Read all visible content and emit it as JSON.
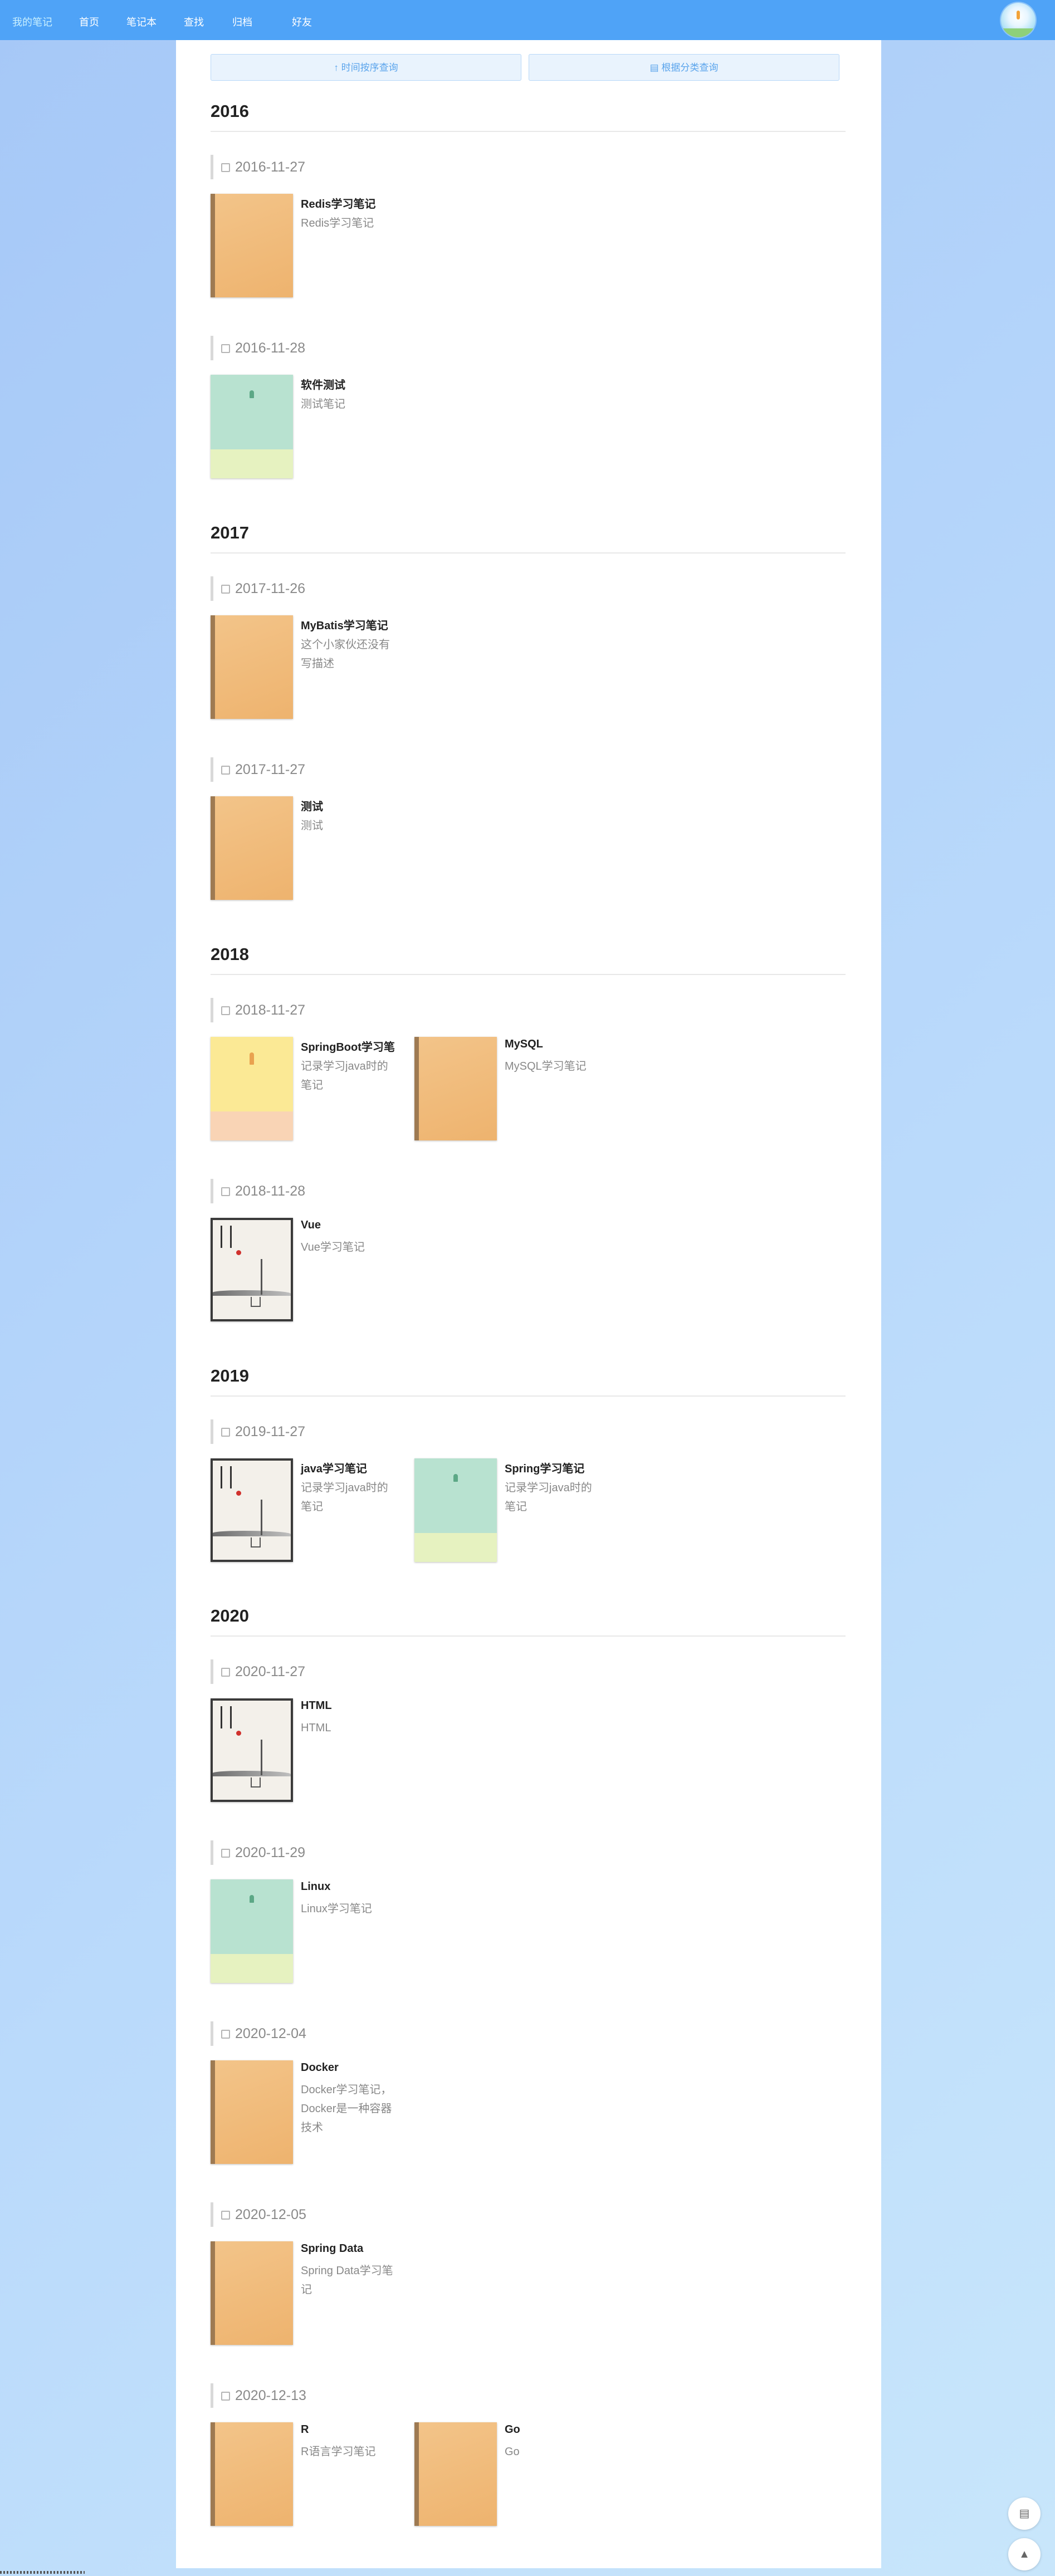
{
  "nav": {
    "brand": "我的笔记",
    "links": [
      "首页",
      "笔记本",
      "查找",
      "归档",
      "好友"
    ]
  },
  "query": {
    "time_order": "时间按序查询",
    "category": "根据分类查询"
  },
  "years": [
    {
      "year": "2016",
      "groups": [
        {
          "date": "2016-11-27",
          "books": [
            {
              "title": "Redis学习笔记",
              "desc": "Redis学习笔记",
              "cover": "orange"
            }
          ]
        },
        {
          "date": "2016-11-28",
          "books": [
            {
              "title": "软件测试",
              "desc": "测试笔记",
              "cover": "green"
            }
          ]
        }
      ]
    },
    {
      "year": "2017",
      "groups": [
        {
          "date": "2017-11-26",
          "books": [
            {
              "title": "MyBatis学习笔记",
              "desc": "这个小家伙还没有写描述",
              "cover": "orange"
            }
          ]
        },
        {
          "date": "2017-11-27",
          "books": [
            {
              "title": "测试",
              "desc": "测试",
              "cover": "orange"
            }
          ]
        }
      ]
    },
    {
      "year": "2018",
      "groups": [
        {
          "date": "2018-11-27",
          "books": [
            {
              "title": "SpringBoot学习笔",
              "desc": "记录学习java时的笔记",
              "cover": "yellow"
            },
            {
              "title": "MySQL",
              "desc": "MySQL学习笔记",
              "cover": "orange"
            }
          ]
        },
        {
          "date": "2018-11-28",
          "books": [
            {
              "title": "Vue",
              "desc": "Vue学习笔记",
              "cover": "ink"
            }
          ]
        }
      ]
    },
    {
      "year": "2019",
      "groups": [
        {
          "date": "2019-11-27",
          "books": [
            {
              "title": "java学习笔记",
              "desc": "记录学习java时的笔记",
              "cover": "ink"
            },
            {
              "title": "Spring学习笔记",
              "desc": "记录学习java时的笔记",
              "cover": "green"
            }
          ]
        }
      ]
    },
    {
      "year": "2020",
      "groups": [
        {
          "date": "2020-11-27",
          "books": [
            {
              "title": "HTML",
              "desc": "HTML",
              "cover": "ink"
            }
          ]
        },
        {
          "date": "2020-11-29",
          "books": [
            {
              "title": "Linux",
              "desc": "Linux学习笔记",
              "cover": "green"
            }
          ]
        },
        {
          "date": "2020-12-04",
          "books": [
            {
              "title": "Docker",
              "desc": "Docker学习笔记，Docker是一种容器技术",
              "cover": "orange"
            }
          ]
        },
        {
          "date": "2020-12-05",
          "books": [
            {
              "title": "Spring Data",
              "desc": "Spring Data学习笔记",
              "cover": "orange"
            }
          ]
        },
        {
          "date": "2020-12-13",
          "books": [
            {
              "title": "R",
              "desc": "R语言学习笔记",
              "cover": "orange"
            },
            {
              "title": "Go",
              "desc": "Go",
              "cover": "orange"
            }
          ]
        }
      ]
    }
  ],
  "colors": {
    "navbar": "#4fa3f7",
    "brand": "#c9f0ff",
    "accent": "#5aa4ec"
  },
  "floating": {
    "doc_icon": "document-icon",
    "top_icon": "arrow-up-icon"
  }
}
